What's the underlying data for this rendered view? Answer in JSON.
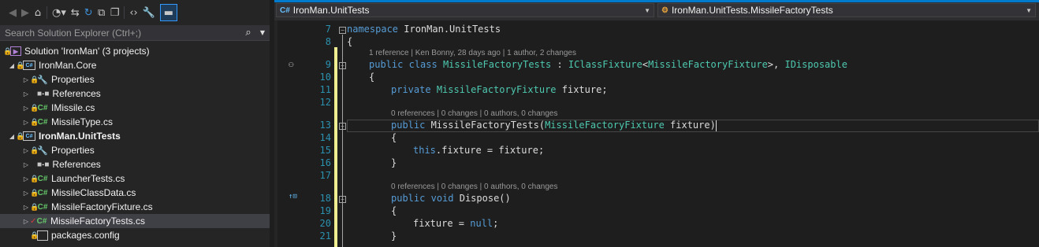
{
  "toolbar": {
    "back_icon": "arrow-left-circle",
    "forward_icon": "arrow-right-circle",
    "home_icon": "home",
    "history_icon": "clock",
    "sync_icon": "sync-arrows",
    "refresh_icon": "refresh",
    "collapse_icon": "collapse-all",
    "copy_icon": "copy",
    "code_icon": "code-brackets",
    "properties_icon": "wrench",
    "preview_icon": "preview-pane"
  },
  "search": {
    "placeholder": "Search Solution Explorer (Ctrl+;)"
  },
  "solution_explorer": {
    "items": [
      {
        "label": "Solution 'IronMan' (3 projects)",
        "icon": "solution"
      },
      {
        "label": "IronMan.Core",
        "icon": "csharp-project"
      },
      {
        "label": "Properties",
        "icon": "wrench"
      },
      {
        "label": "References",
        "icon": "references"
      },
      {
        "label": "IMissile.cs",
        "icon": "csharp-file"
      },
      {
        "label": "MissileType.cs",
        "icon": "csharp-file"
      },
      {
        "label": "IronMan.UnitTests",
        "icon": "csharp-project"
      },
      {
        "label": "Properties",
        "icon": "wrench"
      },
      {
        "label": "References",
        "icon": "references"
      },
      {
        "label": "LauncherTests.cs",
        "icon": "csharp-file"
      },
      {
        "label": "MissileClassData.cs",
        "icon": "csharp-file"
      },
      {
        "label": "MissileFactoryFixture.cs",
        "icon": "csharp-file"
      },
      {
        "label": "MissileFactoryTests.cs",
        "icon": "csharp-file"
      },
      {
        "label": "packages.config",
        "icon": "config-file"
      }
    ]
  },
  "editor": {
    "project_dropdown": "IronMan.UnitTests",
    "member_dropdown": "IronMan.UnitTests.MissileFactoryTests",
    "line_numbers": [
      "7",
      "8",
      "9",
      "10",
      "11",
      "12",
      "13",
      "14",
      "15",
      "16",
      "17",
      "18",
      "19",
      "20",
      "21"
    ],
    "codelens": [
      "1 reference | Ken Bonny, 28 days ago | 1 author, 2 changes",
      "0 references | 0 changes | 0 authors, 0 changes",
      "0 references | 0 changes | 0 authors, 0 changes"
    ],
    "code": {
      "l7_kw": "namespace",
      "l7_name": " IronMan.UnitTests",
      "l8": "{",
      "l9_kw1": "public",
      "l9_kw2": "class",
      "l9_cls": "MissileFactoryTests",
      "l9_colon": " : ",
      "l9_iface1": "IClassFixture",
      "l9_lt": "<",
      "l9_gen": "MissileFactoryFixture",
      "l9_gt": ">, ",
      "l9_iface2": "IDisposable",
      "l10": "{",
      "l11_kw": "private",
      "l11_type": "MissileFactoryFixture",
      "l11_field": " fixture;",
      "l13_kw": "public",
      "l13_ctor": " MissileFactoryTests(",
      "l13_type": "MissileFactoryFixture",
      "l13_param": " fixture)",
      "l14": "{",
      "l15_kw": "this",
      "l15_rest": ".fixture = fixture;",
      "l16": "}",
      "l18_kw1": "public",
      "l18_kw2": "void",
      "l18_rest": " Dispose()",
      "l19": "{",
      "l20_a": "fixture = ",
      "l20_kw": "null",
      "l20_b": ";",
      "l21": "}"
    }
  },
  "colors": {
    "accent": "#007acc",
    "keyword": "#569cd6",
    "type": "#4ec9b0",
    "line_number": "#2b91af",
    "change_bar": "#efef91"
  }
}
